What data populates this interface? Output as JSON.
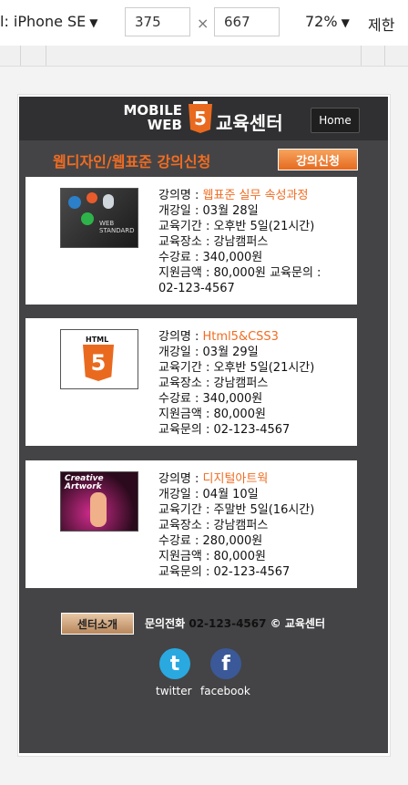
{
  "browser": {
    "device": "l: iPhone SE",
    "width_value": "375",
    "height_value": "667",
    "times": "×",
    "zoom": "72%",
    "limit": "제한"
  },
  "app": {
    "logo_line1": "MOBILE",
    "logo_line2": "WEB",
    "logo_number": "5",
    "title": "교육센터",
    "home": "Home",
    "section_title": "웹디자인/웹표준 강의신청",
    "apply": "강의신청",
    "courses": [
      {
        "lines": [
          "강의명 : ",
          "개강일 : 03월 28일",
          "교육기간 : 오후반 5일(21시간)",
          "교육장소 : 강남캠퍼스",
          "수강료 : 340,000원",
          "지원금액 : 80,000원 교육문의 :",
          "02-123-4567"
        ],
        "name": "웹표준 실무 속성과정"
      },
      {
        "lines": [
          "강의명 : ",
          "개강일 : 03월 29일",
          "교육기간 : 오후반 5일(21시간)",
          "교육장소 : 강남캠퍼스",
          "수강료 : 340,000원",
          "지원금액 : 80,000원",
          "교육문의 : 02-123-4567"
        ],
        "name": "Html5&CSS3"
      },
      {
        "lines": [
          "강의명 : ",
          "개강일 : 04월 10일",
          "교육기간 : 주말반 5일(16시간)",
          "교육장소 : 강남캠퍼스",
          "수강료 : 280,000원",
          "지원금액 : 80,000원",
          "교육문의 : 02-123-4567"
        ],
        "name": "디지털아트웍"
      }
    ],
    "footer_intro": "센터소개",
    "contact_label": "문의전화",
    "contact_phone": "02-123-4567",
    "copyright": "© 교육센터",
    "twitter": "twitter",
    "facebook": "facebook"
  },
  "colors": {
    "accent": "#f06c22",
    "dark": "#444446"
  }
}
